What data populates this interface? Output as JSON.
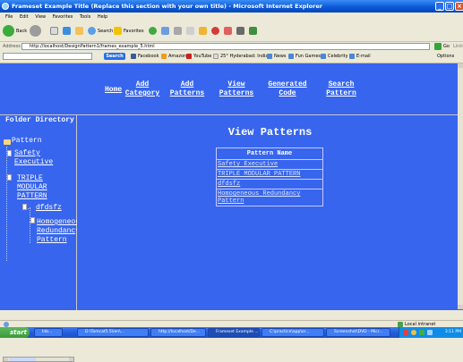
{
  "window": {
    "title": "Frameset Example Title (Replace this section with your own title) - Microsoft Internet Explorer",
    "controls": {
      "minimize": "_",
      "maximize": "□",
      "close": "×"
    }
  },
  "menu": [
    "File",
    "Edit",
    "View",
    "Favorites",
    "Tools",
    "Help"
  ],
  "toolbar": {
    "back": "Back",
    "search": "Search",
    "favorites": "Favorites"
  },
  "address": {
    "label": "Address",
    "url": "http://localhost/DesignPattern1/frames_example_5.html",
    "go": "Go",
    "links": "Links"
  },
  "search_toolbar": {
    "button": "Search",
    "items": [
      "Facebook",
      "Amazon",
      "YouTube",
      "25° Hyderabad: India",
      "News",
      "Fun Games",
      "Celebrity",
      "E-mail"
    ],
    "options": "Options"
  },
  "top_nav": [
    {
      "label": "Home"
    },
    {
      "label": "Add\nCategory"
    },
    {
      "label": "Add\nPatterns"
    },
    {
      "label": "View\nPatterns"
    },
    {
      "label": "Generated\nCode"
    },
    {
      "label": "Search\nPattern"
    }
  ],
  "left_frame": {
    "title": "Folder Directory",
    "root": "Pattern",
    "items": [
      {
        "label": "Safety\nExecutive"
      },
      {
        "label": "TRIPLE\nMODULAR\nPATTERN"
      },
      {
        "label": "dfdsfz"
      },
      {
        "label": "Homogeneous\nRedundancy\nPattern"
      }
    ]
  },
  "main_frame": {
    "title": "View Patterns",
    "table_header": "Pattern Name",
    "rows": [
      "Safety Executive",
      "TRIPLE MODULAR PATTERN",
      "dfdsfz",
      "Homogeneous Redundancy Pattern"
    ]
  },
  "status": {
    "zone": "Local intranet"
  },
  "taskbar": {
    "start": "start",
    "tasks": [
      "Inb...",
      "D:\\Tomcat5.5\\ien\\...",
      "http://localhost/De...",
      "Frameset Example ...",
      "C:\\practice\\app\\or...",
      "Screenshot\\DVD - Micr..."
    ],
    "clock": "3:11 PM"
  },
  "colors": {
    "page_background": "#3765ee",
    "title_bar": "#0a56d8",
    "chrome": "#ece9d8",
    "taskbar": "#245edb"
  }
}
